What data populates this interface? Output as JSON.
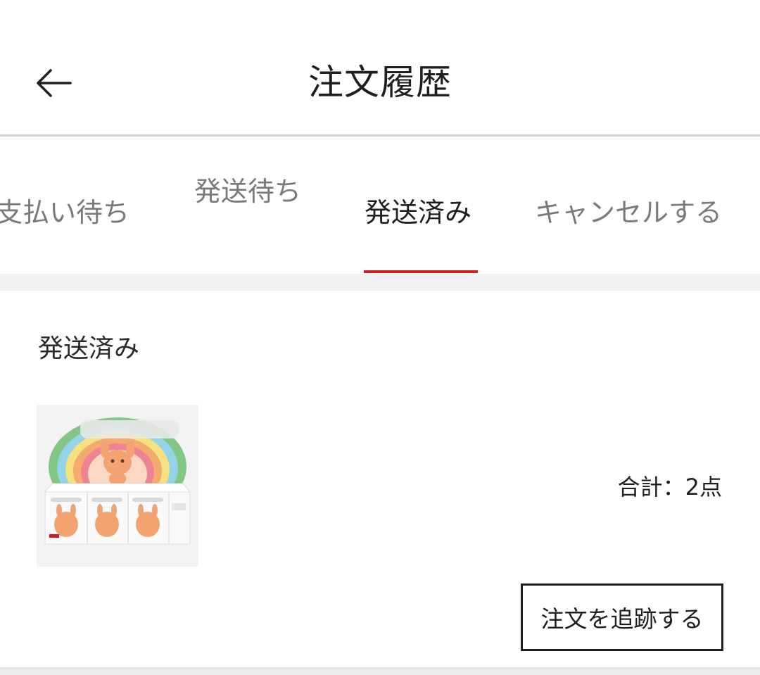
{
  "header": {
    "title": "注文履歴",
    "back_icon": "arrow-left-icon"
  },
  "tabs": [
    {
      "label": "支払い待ち",
      "active": false
    },
    {
      "label": "発送待ち",
      "active": false
    },
    {
      "label": "発送済み",
      "active": true
    },
    {
      "label": "キャンセルする",
      "active": false
    }
  ],
  "colors": {
    "accent": "#d71920",
    "text": "#1f1f1f",
    "muted": "#7a7a7a",
    "divider": "#d4d4d4"
  },
  "order": {
    "status": "発送済み",
    "product_image": "product-box-set-image",
    "total_text": "合計：2点",
    "track_button": "注文を追跡する"
  }
}
